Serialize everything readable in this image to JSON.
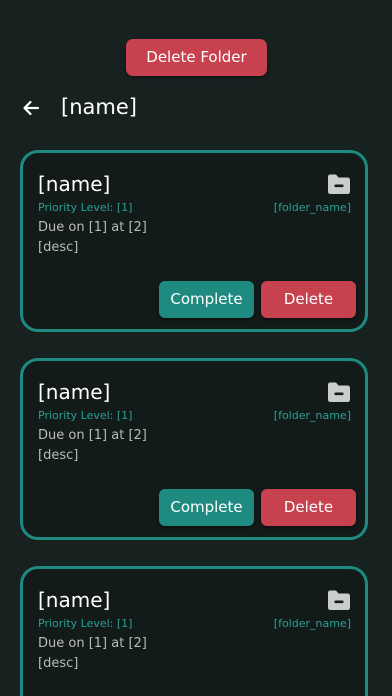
{
  "header": {
    "delete_folder_label": "Delete Folder",
    "title": "[name]",
    "back_icon": "arrow-left-icon"
  },
  "tasks": [
    {
      "title": "[name]",
      "priority": "Priority Level: [1]",
      "folder": "[folder_name]",
      "due": "Due on [1] at [2]",
      "desc": "[desc]",
      "complete_label": "Complete",
      "delete_label": "Delete"
    },
    {
      "title": "[name]",
      "priority": "Priority Level: [1]",
      "folder": "[folder_name]",
      "due": "Due on [1] at [2]",
      "desc": "[desc]",
      "complete_label": "Complete",
      "delete_label": "Delete"
    },
    {
      "title": "[name]",
      "priority": "Priority Level: [1]",
      "folder": "[folder_name]",
      "due": "Due on [1] at [2]",
      "desc": "[desc]"
    }
  ],
  "colors": {
    "background": "#162120",
    "accent": "#1e8a80",
    "danger": "#c8414f",
    "accent_text": "#2aa092"
  }
}
